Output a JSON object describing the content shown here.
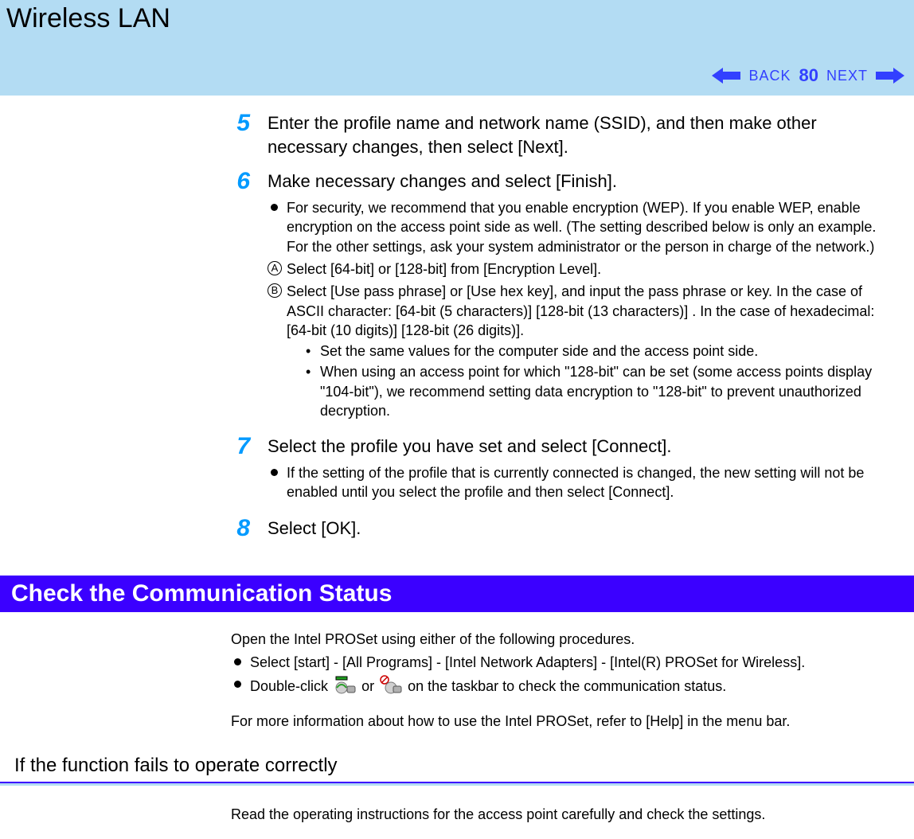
{
  "header": {
    "title": "Wireless LAN",
    "back_label": "BACK",
    "next_label": "NEXT",
    "page_number": "80"
  },
  "steps": {
    "s5": {
      "num": "5",
      "text": "Enter the profile name and network name (SSID), and then make other necessary changes, then select [Next]."
    },
    "s6": {
      "num": "6",
      "text": "Make necessary changes and select [Finish].",
      "bullet1": "For security, we recommend that you enable encryption (WEP). If you enable WEP, enable encryption on the access point side as well. (The setting described below is only an example. For the other settings, ask your system administrator or the person in charge of the network.)",
      "circA_num": "A",
      "circA": "Select [64-bit] or [128-bit] from [Encryption Level].",
      "circB_num": "B",
      "circB": "Select [Use pass phrase] or [Use hex key], and input the pass phrase or key. In the case of ASCII character: [64-bit (5 characters)] [128-bit (13 characters)] . In the case of hexadecimal: [64-bit (10 digits)] [128-bit (26 digits)].",
      "sub1": "Set the same values for the computer side and the access point side.",
      "sub2": "When using an access point for which \"128-bit\" can be set (some access points display \"104-bit\"), we recommend setting data encryption to \"128-bit\" to prevent unauthorized decryption."
    },
    "s7": {
      "num": "7",
      "text": "Select the profile you have set and select [Connect].",
      "bullet1": "If the setting of the profile that is currently connected is changed, the new setting will not be enabled until you select the profile and then select [Connect]."
    },
    "s8": {
      "num": "8",
      "text": "Select [OK]."
    }
  },
  "section": {
    "banner": "Check the Communication Status",
    "intro": "Open the Intel PROSet using either of the following procedures.",
    "bullet_a": "Select [start] - [All Programs] - [Intel Network Adapters] - [Intel(R) PROSet for Wireless].",
    "bullet_b_pre": "Double-click ",
    "bullet_b_mid": " or ",
    "bullet_b_post": " on the taskbar to check the communication status.",
    "more_info": "For more information about how to use the Intel PROSet, refer to [Help] in the menu bar."
  },
  "subsection": {
    "title": "If the function fails to operate correctly",
    "text": "Read the operating instructions for the access point carefully and check the settings."
  }
}
